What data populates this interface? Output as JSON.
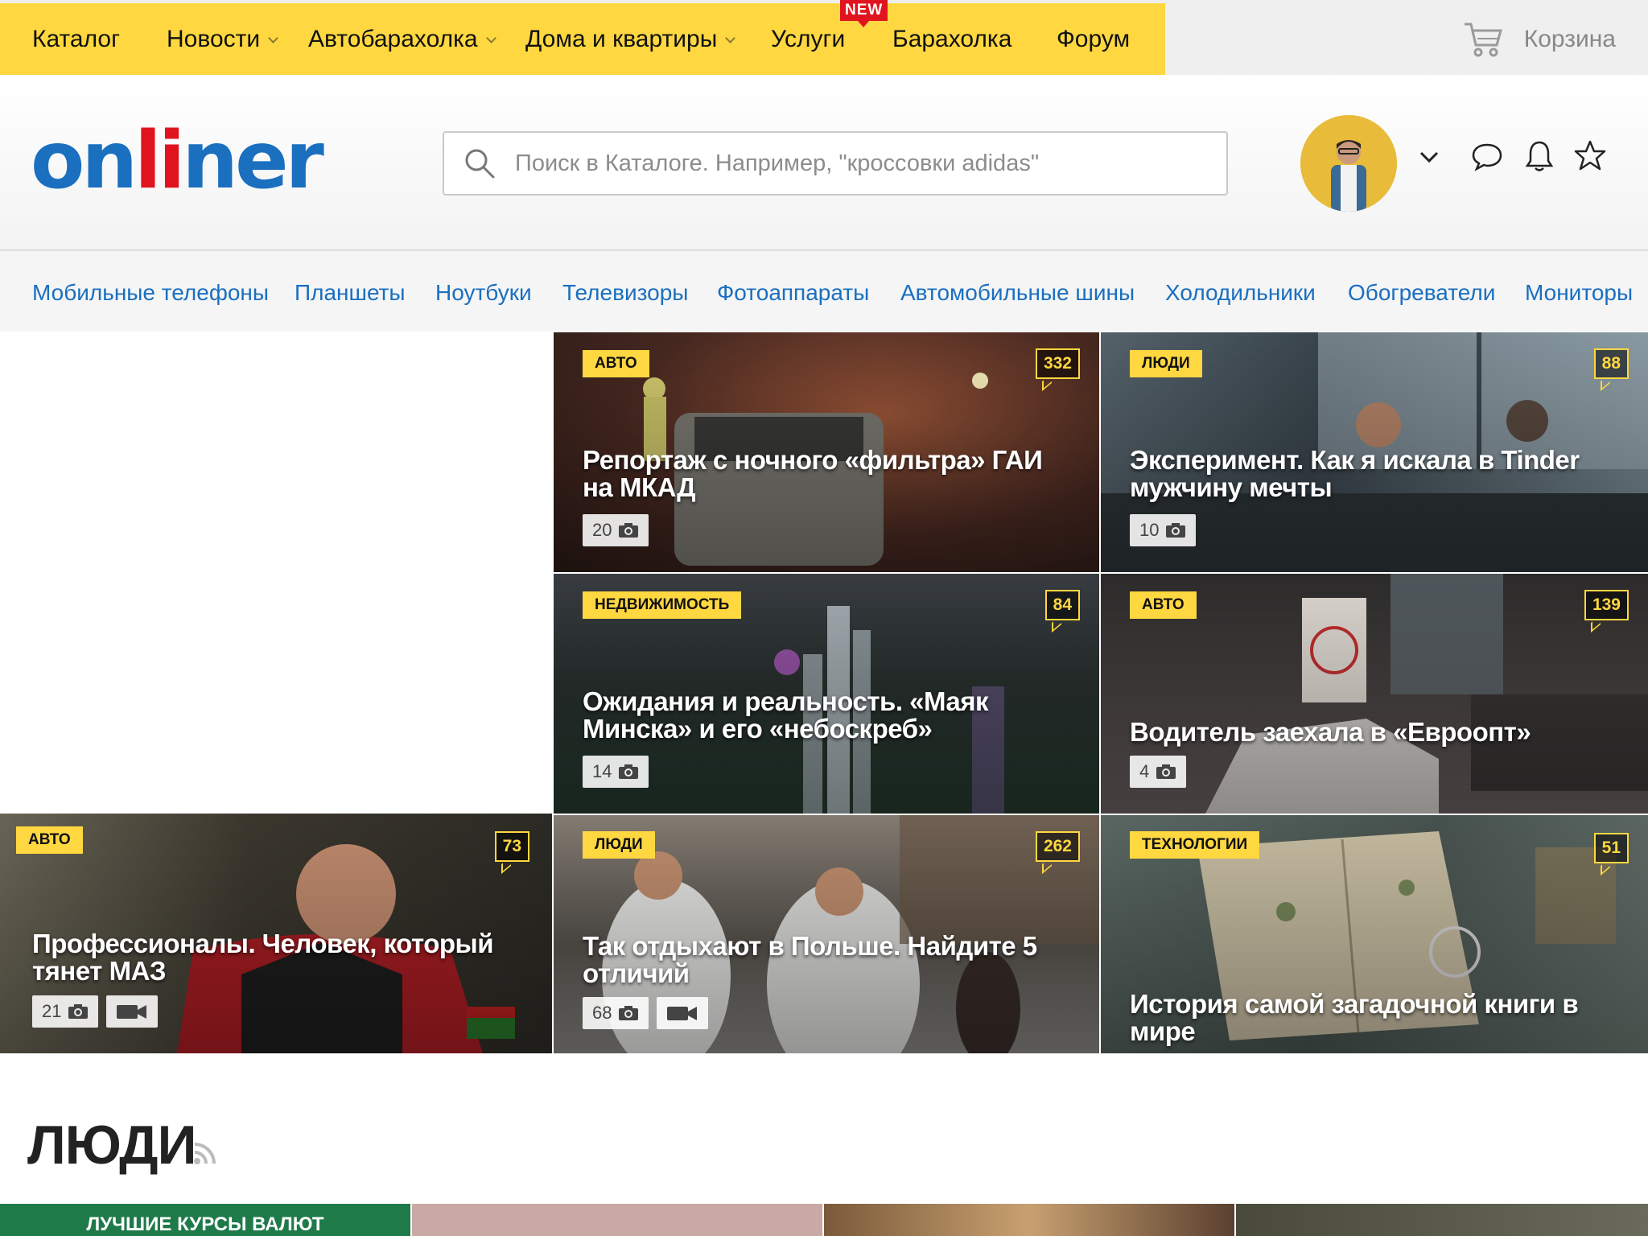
{
  "topnav": {
    "items": [
      {
        "label": "Каталог",
        "dropdown": false
      },
      {
        "label": "Новости",
        "dropdown": true
      },
      {
        "label": "Автобарахолка",
        "dropdown": true
      },
      {
        "label": "Дома и квартиры",
        "dropdown": true
      },
      {
        "label": "Услуги",
        "dropdown": false
      },
      {
        "label": "Барахолка",
        "dropdown": false
      },
      {
        "label": "Форум",
        "dropdown": false
      }
    ],
    "new_badge": "NEW",
    "cart_label": "Корзина"
  },
  "header": {
    "logo_pre": "on",
    "logo_accent": "li",
    "logo_post": "ner",
    "search_placeholder": "Поиск в Каталоге. Например, \"кроссовки adidas\""
  },
  "catnav": {
    "items": [
      "Мобильные телефоны",
      "Планшеты",
      "Ноутбуки",
      "Телевизоры",
      "Фотоаппараты",
      "Автомобильные шины",
      "Холодильники",
      "Обогреватели",
      "Мониторы"
    ]
  },
  "news": [
    {
      "tag": "АВТО",
      "comments": "332",
      "title": "Репортаж с ночного «фильтра» ГАИ на МКАД",
      "photos": "20",
      "video": false,
      "bg": "#5a3a2a"
    },
    {
      "tag": "ЛЮДИ",
      "comments": "88",
      "title": "Эксперимент. Как я искала в Tinder мужчину мечты",
      "photos": "10",
      "video": false,
      "bg": "#3d4a52"
    },
    {
      "tag": "НЕДВИЖИМОСТЬ",
      "comments": "84",
      "title": "Ожидания и реальность. «Маяк Минска» и его «небоскреб»",
      "photos": "14",
      "video": false,
      "bg": "#2f3a3a"
    },
    {
      "tag": "АВТО",
      "comments": "139",
      "title": "Водитель заехала в «Евроопт»",
      "photos": "4",
      "video": false,
      "bg": "#4a4545"
    },
    {
      "tag": "АВТО",
      "comments": "73",
      "title": "Профессионалы. Человек, который тянет МАЗ",
      "photos": "21",
      "video": true,
      "bg": "#4d4538"
    },
    {
      "tag": "ЛЮДИ",
      "comments": "262",
      "title": "Так отдыхают в Польше. Найдите 5 отличий",
      "photos": "68",
      "video": true,
      "bg": "#6b6660"
    },
    {
      "tag": "ТЕХНОЛОГИИ",
      "comments": "51",
      "title": "История самой загадочной книги в мире",
      "photos": "",
      "video": false,
      "bg": "#56635f"
    }
  ],
  "section": {
    "title": "ЛЮДИ",
    "strip_label": "ЛУЧШИЕ КУРСЫ ВАЛЮТ"
  },
  "colors": {
    "accent_yellow": "#ffd740",
    "brand_blue": "#1a6fbf",
    "brand_red": "#e0141e"
  }
}
